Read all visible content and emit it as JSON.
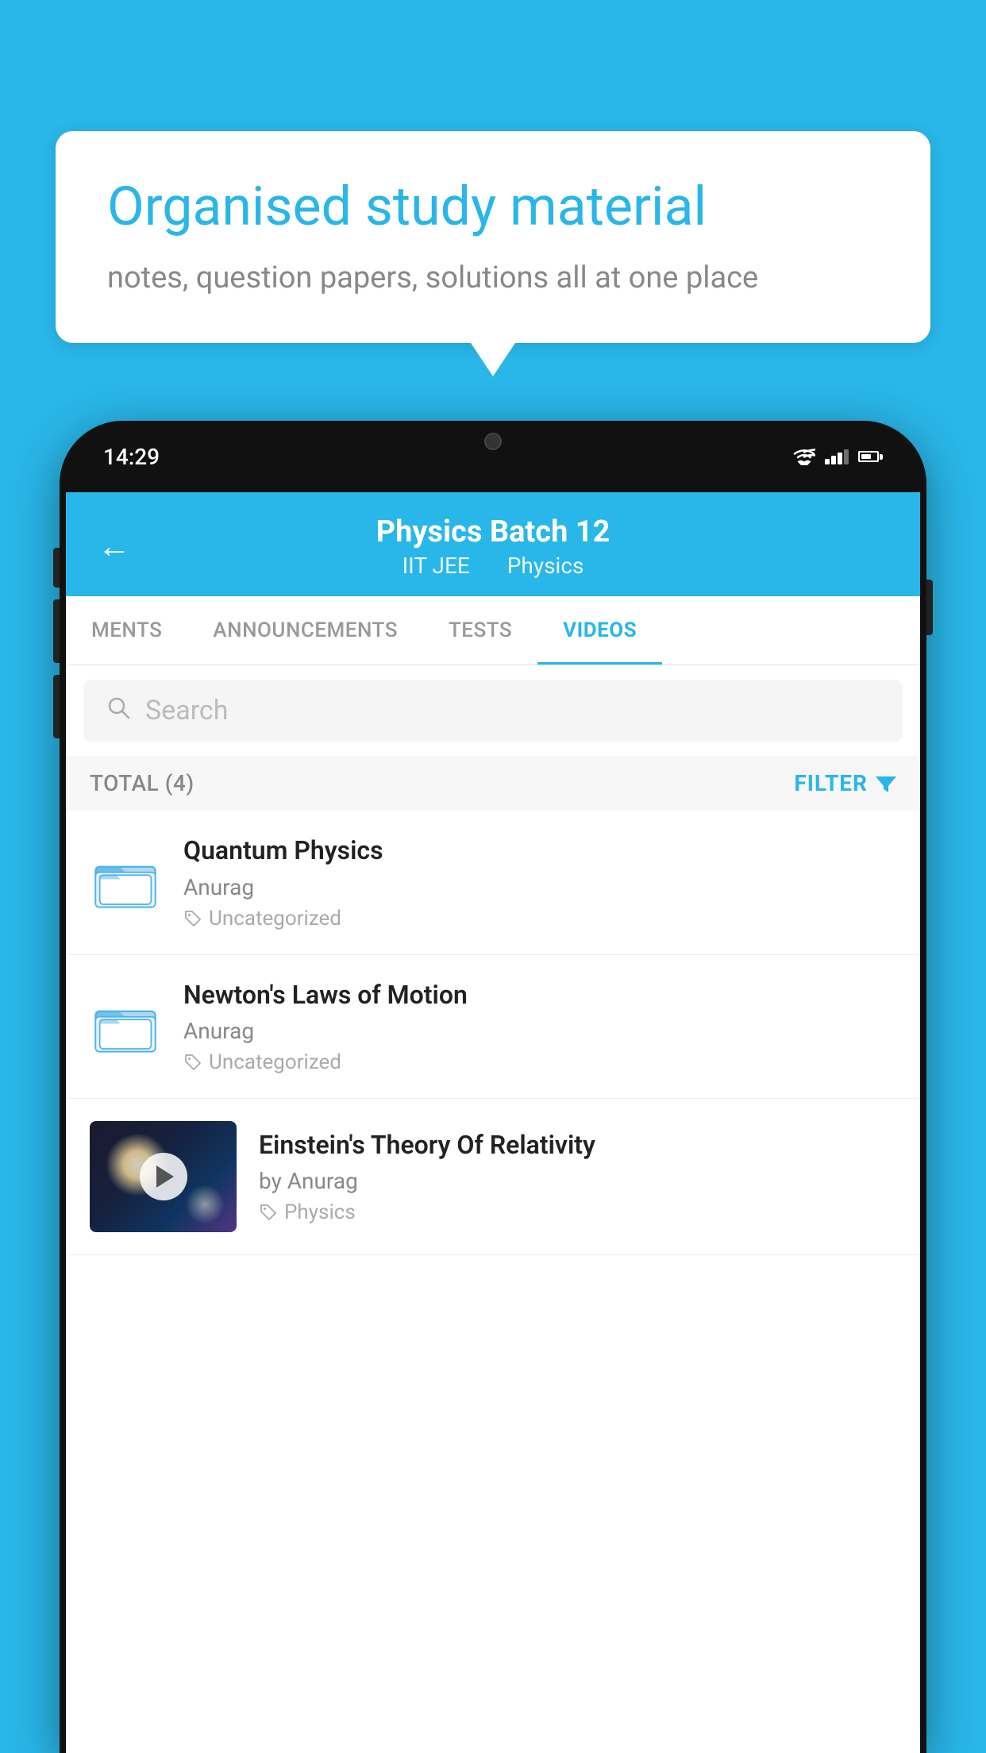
{
  "background_color": "#29b6e8",
  "speech_bubble": {
    "headline": "Organised study material",
    "subtext": "notes, question papers, solutions all at one place"
  },
  "status_bar": {
    "time": "14:29"
  },
  "app_header": {
    "title": "Physics Batch 12",
    "subtitle_part1": "IIT JEE",
    "subtitle_part2": "Physics",
    "back_label": "←"
  },
  "tabs": [
    {
      "label": "MENTS",
      "active": false
    },
    {
      "label": "ANNOUNCEMENTS",
      "active": false
    },
    {
      "label": "TESTS",
      "active": false
    },
    {
      "label": "VIDEOS",
      "active": true
    }
  ],
  "search": {
    "placeholder": "Search"
  },
  "filter_row": {
    "total_label": "TOTAL (4)",
    "filter_label": "FILTER"
  },
  "video_items": [
    {
      "id": "1",
      "title": "Quantum Physics",
      "author": "Anurag",
      "tag": "Uncategorized",
      "type": "folder",
      "has_thumbnail": false
    },
    {
      "id": "2",
      "title": "Newton's Laws of Motion",
      "author": "Anurag",
      "tag": "Uncategorized",
      "type": "folder",
      "has_thumbnail": false
    },
    {
      "id": "3",
      "title": "Einstein's Theory Of Relativity",
      "author": "by Anurag",
      "tag": "Physics",
      "type": "video",
      "has_thumbnail": true
    }
  ],
  "icons": {
    "folder": "folder",
    "tag": "🏷",
    "filter": "▼",
    "back": "←",
    "search": "🔍"
  }
}
